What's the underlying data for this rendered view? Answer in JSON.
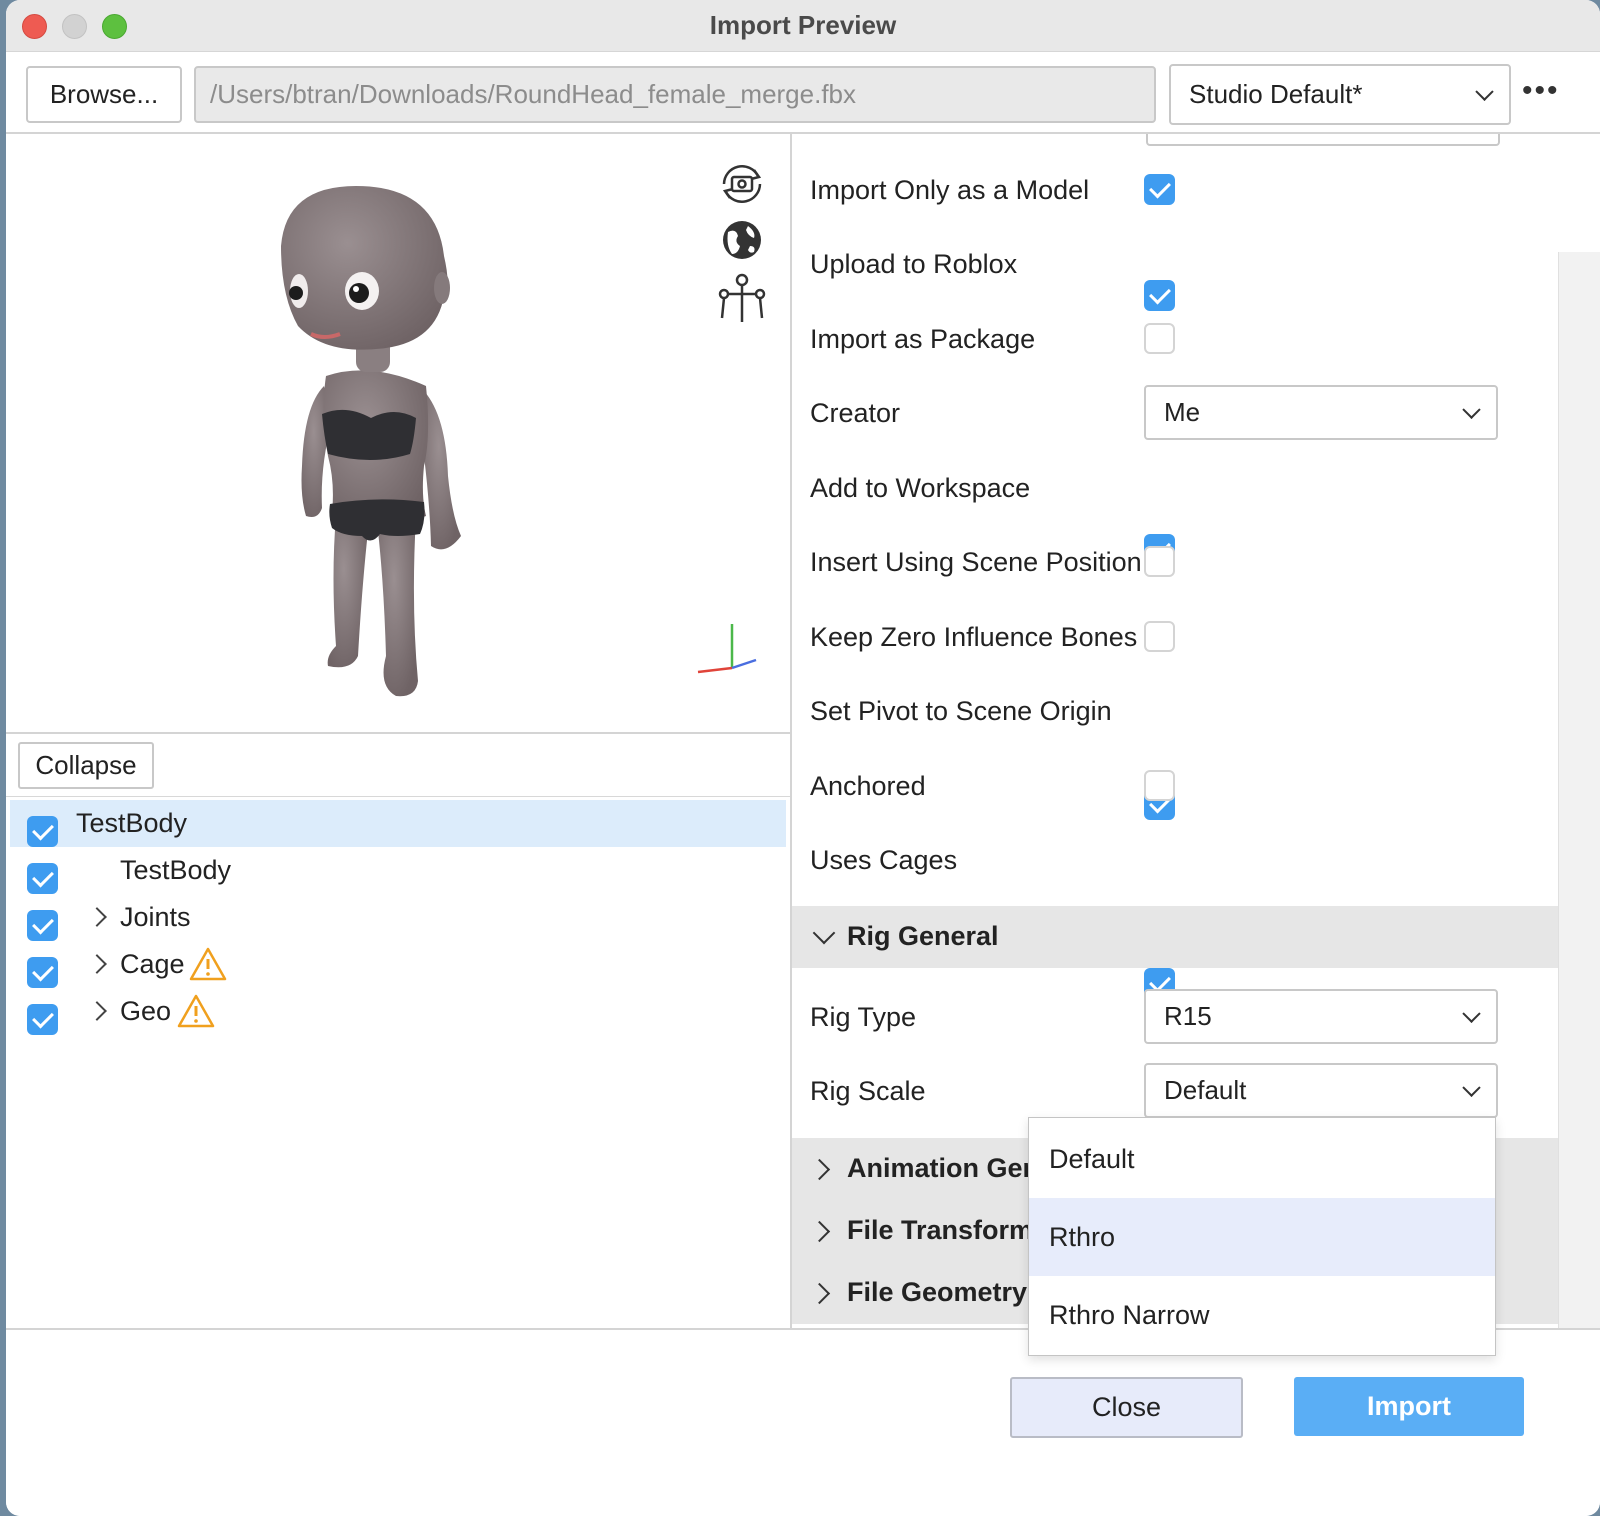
{
  "window": {
    "title": "Import Preview"
  },
  "toolbar": {
    "browse_label": "Browse...",
    "file_path": "/Users/btran/Downloads/RoundHead_female_merge.fbx",
    "preset_value": "Studio Default*",
    "more_label": "•••"
  },
  "viewport": {
    "icons": [
      "camera-rotate-icon",
      "globe-icon",
      "rig-icon"
    ],
    "axis_colors": {
      "x": "#e0443a",
      "y": "#4cb84a",
      "z": "#4a6ee0"
    }
  },
  "tree": {
    "collapse_label": "Collapse",
    "items": [
      {
        "label": "TestBody",
        "checked": true,
        "selected": true,
        "expandable": false,
        "warning": false
      },
      {
        "label": "TestBody",
        "checked": true,
        "selected": false,
        "expandable": false,
        "warning": false
      },
      {
        "label": "Joints",
        "checked": true,
        "selected": false,
        "expandable": true,
        "warning": false
      },
      {
        "label": "Cage",
        "checked": true,
        "selected": false,
        "expandable": true,
        "warning": true
      },
      {
        "label": "Geo",
        "checked": true,
        "selected": false,
        "expandable": true,
        "warning": true
      }
    ]
  },
  "properties": {
    "items": [
      {
        "label": "Import Only as a Model",
        "checked": true
      },
      {
        "label": "Upload to Roblox",
        "checked": true
      },
      {
        "label": "Import as Package",
        "checked": false
      },
      {
        "label": "Creator",
        "value": "Me"
      },
      {
        "label": "Add to Workspace",
        "checked": true
      },
      {
        "label": "Insert Using Scene Position",
        "checked": false
      },
      {
        "label": "Keep Zero Influence Bones",
        "checked": false
      },
      {
        "label": "Set Pivot to Scene Origin",
        "checked": true
      },
      {
        "label": "Anchored",
        "checked": false
      },
      {
        "label": "Uses Cages",
        "checked": true
      }
    ],
    "rig_general": {
      "title": "Rig General",
      "rig_type_label": "Rig Type",
      "rig_type_value": "R15",
      "rig_scale_label": "Rig Scale",
      "rig_scale_value": "Default"
    },
    "collapsed_sections": [
      "Animation General",
      "File Transform",
      "File Geometry"
    ]
  },
  "rig_scale_dropdown": {
    "options": [
      "Default",
      "Rthro",
      "Rthro Narrow"
    ],
    "highlighted": "Rthro"
  },
  "footer": {
    "close_label": "Close",
    "import_label": "Import"
  },
  "colors": {
    "accent": "#3e9cf0",
    "import_button": "#5aaef5",
    "warning": "#f0a01e",
    "selection": "#dcecfb"
  }
}
